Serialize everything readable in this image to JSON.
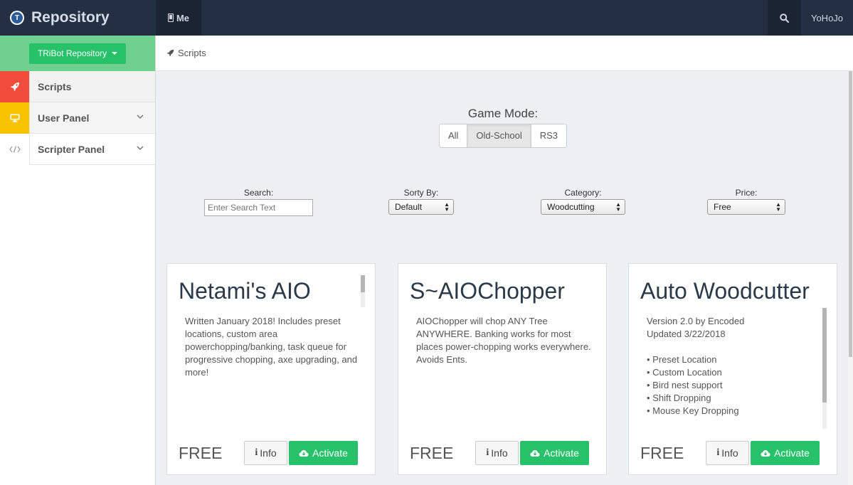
{
  "topbar": {
    "logo_letter": "T",
    "brand_title": "Repository",
    "me_tab": "Me",
    "user_name": "YoHoJo"
  },
  "sidebar": {
    "repo_dropdown": "TRiBot Repository",
    "items": [
      {
        "label": "Scripts",
        "color": "#f24c3d"
      },
      {
        "label": "User Panel",
        "color": "#f7c200"
      },
      {
        "label": "Scripter Panel",
        "color": "#ffffff"
      }
    ]
  },
  "breadcrumb": {
    "label": "Scripts"
  },
  "game_mode": {
    "label": "Game Mode:",
    "options": [
      "All",
      "Old-School",
      "RS3"
    ],
    "selected": "Old-School"
  },
  "filters": {
    "search_label": "Search:",
    "search_placeholder": "Enter Search Text",
    "sort_label": "Sorty By:",
    "sort_value": "Default",
    "category_label": "Category:",
    "category_value": "Woodcutting",
    "price_label": "Price:",
    "price_value": "Free"
  },
  "cards": [
    {
      "title": "Netami's AIO",
      "description": "Written January 2018! Includes preset locations, custom area powerchopping/banking, task queue for progressive chopping, axe upgrading, and more!",
      "price": "FREE",
      "info_label": "Info",
      "activate_label": "Activate"
    },
    {
      "title": "S~AIOChopper",
      "description": "AIOChopper will chop ANY Tree ANYWHERE. Banking works for most places power-chopping works everywhere. Avoids Ents.",
      "price": "FREE",
      "info_label": "Info",
      "activate_label": "Activate"
    },
    {
      "title": "Auto Woodcutter",
      "description": "Version 2.0 by Encoded\nUpdated 3/22/2018\n\n• Preset Location\n• Custom Location\n• Bird nest support\n• Shift Dropping\n• Mouse Key Dropping",
      "price": "FREE",
      "info_label": "Info",
      "activate_label": "Activate"
    }
  ],
  "colors": {
    "accent_green": "#27c16a",
    "topbar": "#233044"
  }
}
